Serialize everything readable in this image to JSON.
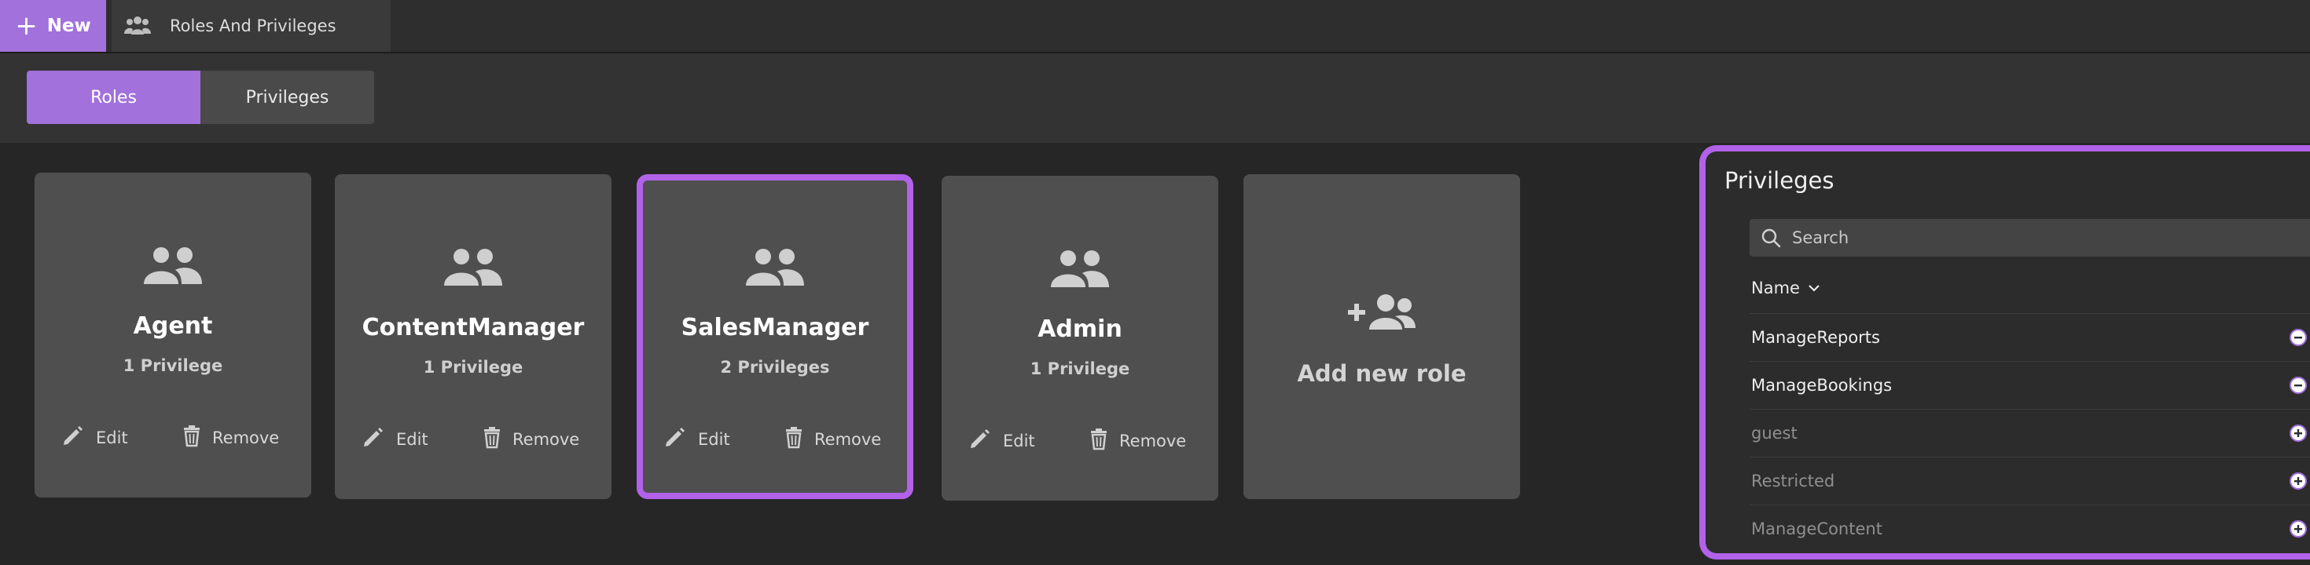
{
  "tabbar": {
    "new_label": "New",
    "page_tab_label": "Roles And Privileges",
    "accent": "#a271dc"
  },
  "segment": {
    "roles_label": "Roles",
    "privileges_label": "Privileges",
    "active": "Roles"
  },
  "roles": [
    {
      "name": "Agent",
      "count": "1 Privilege",
      "edit_label": "Edit",
      "remove_label": "Remove",
      "selected": false
    },
    {
      "name": "ContentManager",
      "count": "1 Privilege",
      "edit_label": "Edit",
      "remove_label": "Remove",
      "selected": false
    },
    {
      "name": "SalesManager",
      "count": "2 Privileges",
      "edit_label": "Edit",
      "remove_label": "Remove",
      "selected": true
    },
    {
      "name": "Admin",
      "count": "1 Privilege",
      "edit_label": "Edit",
      "remove_label": "Remove",
      "selected": false
    }
  ],
  "add_role": {
    "label": "Add new role",
    "icon": "add-group-icon"
  },
  "panel": {
    "title": "Privileges",
    "search_placeholder": "Search",
    "column_header": "Name",
    "highlight": "#b262e8",
    "items": [
      {
        "name": "ManageReports",
        "assigned": true,
        "action_icon": "minus-circle-icon"
      },
      {
        "name": "ManageBookings",
        "assigned": true,
        "action_icon": "minus-circle-icon"
      },
      {
        "name": "guest",
        "assigned": false,
        "action_icon": "plus-circle-icon"
      },
      {
        "name": "Restricted",
        "assigned": false,
        "action_icon": "plus-circle-icon"
      },
      {
        "name": "ManageContent",
        "assigned": false,
        "action_icon": "plus-circle-icon"
      }
    ]
  }
}
